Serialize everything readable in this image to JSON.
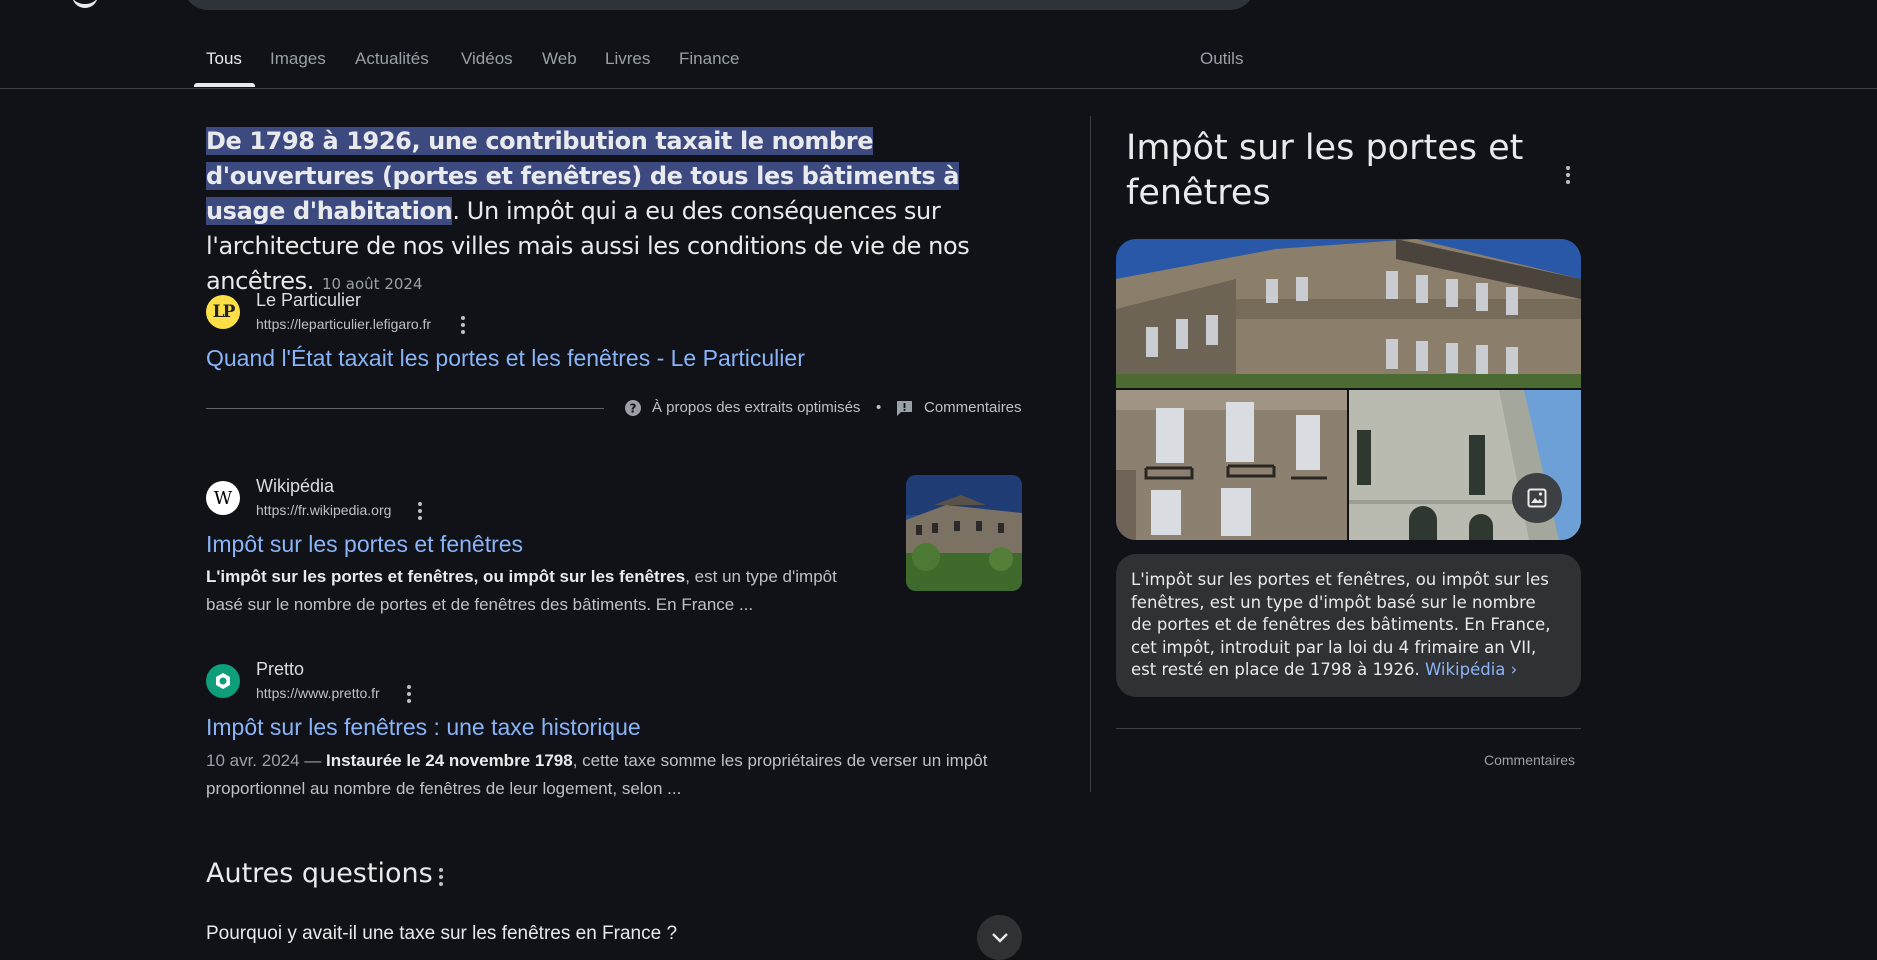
{
  "tabs": [
    {
      "label": "Tous",
      "active": true
    },
    {
      "label": "Images"
    },
    {
      "label": "Actualités"
    },
    {
      "label": "Vidéos"
    },
    {
      "label": "Web"
    },
    {
      "label": "Livres"
    },
    {
      "label": "Finance"
    }
  ],
  "tools_label": "Outils",
  "snippet": {
    "highlight": "De 1798 à 1926, une contribution taxait le nombre d'ouvertures (portes et fenêtres) de tous les bâtiments à usage d'habitation",
    "rest": ". Un impôt qui a eu des conséquences sur l'architecture de nos villes mais aussi les conditions de vie de nos ancêtres.",
    "date": "10 août 2024",
    "source": {
      "favicon_text": "LP",
      "name": "Le Particulier",
      "url": "https://leparticulier.lefigaro.fr",
      "title": "Quand l'État taxait les portes et les fenêtres - Le Particulier"
    },
    "about_label": "À propos des extraits optimisés",
    "separator": "•",
    "feedback_label": "Commentaires"
  },
  "results": [
    {
      "favicon_text": "W",
      "name": "Wikipédia",
      "url": "https://fr.wikipedia.org",
      "title": "Impôt sur les portes et fenêtres",
      "desc_bold": "L'impôt sur les portes et fenêtres, ou impôt sur les fenêtres",
      "desc_rest": ", est un type d'impôt basé sur le nombre de portes et de fenêtres des bâtiments. En France ..."
    },
    {
      "name": "Pretto",
      "url": "https://www.pretto.fr",
      "title": "Impôt sur les fenêtres : une taxe historique",
      "desc_date": "10 avr. 2024 —",
      "desc_bold": "Instaurée le 24 novembre 1798",
      "desc_rest": ", cette taxe somme les propriétaires de verser un impôt proportionnel au nombre de fenêtres de leur logement, selon ..."
    }
  ],
  "people_also_ask": {
    "heading": "Autres questions",
    "first_question": "Pourquoi y avait-il une taxe sur les fenêtres en France ?"
  },
  "knowledge_panel": {
    "title": "Impôt sur les portes et fenêtres",
    "description": "L'impôt sur les portes et fenêtres, ou impôt sur les fenêtres, est un type d'impôt basé sur le nombre de portes et de fenêtres des bâtiments. En France, cet impôt, introduit par la loi du 4 frimaire an VII, est resté en place de 1798 à 1926.",
    "source_link": "Wikipédia ›",
    "feedback_label": "Commentaires"
  },
  "colors": {
    "background": "#101218",
    "link": "#8ab4f8",
    "highlight": "#3d4a80",
    "panel": "#303134"
  }
}
